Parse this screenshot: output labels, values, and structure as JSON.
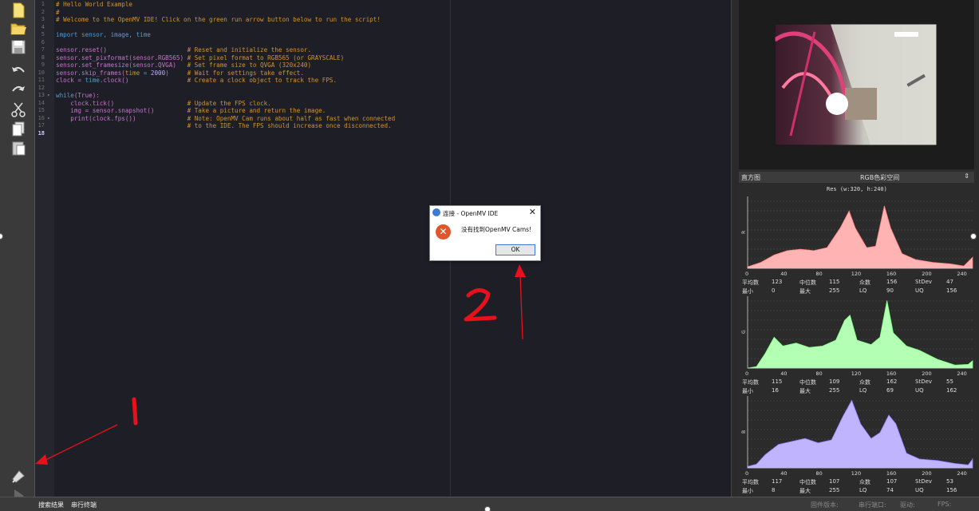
{
  "editor": {
    "lines": [
      {
        "n": "1",
        "parts": [
          {
            "t": "# Hello World Example",
            "c": "c-com"
          }
        ]
      },
      {
        "n": "2",
        "parts": [
          {
            "t": "#",
            "c": "c-com"
          }
        ]
      },
      {
        "n": "3",
        "parts": [
          {
            "t": "# Welcome to the OpenMV IDE! Click on the green run arrow button below to run the script!",
            "c": "c-com"
          }
        ]
      },
      {
        "n": "4",
        "parts": []
      },
      {
        "n": "5",
        "parts": [
          {
            "t": "import sensor, image, time",
            "c": "c-def"
          }
        ]
      },
      {
        "n": "6",
        "parts": []
      },
      {
        "n": "7",
        "parts": [
          {
            "t": "sensor.reset()                      ",
            "c": "c-fn"
          },
          {
            "t": "# Reset and initialize the sensor.",
            "c": "c-com"
          }
        ]
      },
      {
        "n": "8",
        "parts": [
          {
            "t": "sensor.set_pixformat(sensor.RGB565) ",
            "c": "c-fn"
          },
          {
            "t": "# Set pixel format to RGB565 (or GRAYSCALE)",
            "c": "c-com"
          }
        ]
      },
      {
        "n": "9",
        "parts": [
          {
            "t": "sensor.set_framesize(sensor.QVGA)   ",
            "c": "c-fn"
          },
          {
            "t": "# Set frame size to QVGA (320x240)",
            "c": "c-com"
          }
        ]
      },
      {
        "n": "10",
        "parts": [
          {
            "t": "sensor.skip_frames(",
            "c": "c-fn"
          },
          {
            "t": "time",
            "c": "c-com"
          },
          {
            "t": " = ",
            "c": "c-def"
          },
          {
            "t": "2000",
            "c": "c-num"
          },
          {
            "t": ")     ",
            "c": "c-fn"
          },
          {
            "t": "# Wait for settings take effect.",
            "c": "c-com"
          }
        ]
      },
      {
        "n": "11",
        "parts": [
          {
            "t": "clock = ",
            "c": "c-fn"
          },
          {
            "t": "time",
            "c": "c-def"
          },
          {
            "t": ".clock()                ",
            "c": "c-fn"
          },
          {
            "t": "# Create a clock object to track the FPS.",
            "c": "c-com"
          }
        ]
      },
      {
        "n": "12",
        "parts": []
      },
      {
        "n": "13",
        "parts": [
          {
            "t": "while",
            "c": "c-def"
          },
          {
            "t": "(True):",
            "c": "c-fn"
          }
        ]
      },
      {
        "n": "14",
        "parts": [
          {
            "t": "    clock.tick()                    ",
            "c": "c-fn"
          },
          {
            "t": "# Update the FPS clock.",
            "c": "c-com"
          }
        ]
      },
      {
        "n": "15",
        "parts": [
          {
            "t": "    img = sensor.snapshot()         ",
            "c": "c-fn"
          },
          {
            "t": "# Take a picture and return the image.",
            "c": "c-com"
          }
        ]
      },
      {
        "n": "16",
        "parts": [
          {
            "t": "    print(clock.fps())              ",
            "c": "c-fn"
          },
          {
            "t": "# Note: OpenMV Cam runs about half as fast when connected",
            "c": "c-com"
          }
        ]
      },
      {
        "n": "17",
        "parts": [
          {
            "t": "                                    ",
            "c": "c-fn"
          },
          {
            "t": "# to the IDE. The FPS should increase once disconnected.",
            "c": "c-com"
          }
        ]
      },
      {
        "n": "18",
        "parts": []
      }
    ]
  },
  "histogram": {
    "title": "直方图",
    "colorspace": "RGB色彩空间",
    "resolution": "Res (w:320, h:240)",
    "x_ticks": [
      "0",
      "40",
      "80",
      "120",
      "160",
      "200",
      "240"
    ],
    "channels": [
      {
        "label": "R",
        "color": "#ffb3b3",
        "stroke": "#ff8080",
        "stats": {
          "mean_label": "平均数",
          "mean": "123",
          "median_label": "中位数",
          "median": "115",
          "mode_label": "众数",
          "mode": "156",
          "stdev_label": "StDev",
          "stdev": "47",
          "min_label": "最小",
          "min": "0",
          "max_label": "最大",
          "max": "255",
          "lq_label": "LQ",
          "lq": "90",
          "uq_label": "UQ",
          "uq": "156"
        }
      },
      {
        "label": "G",
        "color": "#b3ffb3",
        "stroke": "#80ff80",
        "stats": {
          "mean_label": "平均数",
          "mean": "115",
          "median_label": "中位数",
          "median": "109",
          "mode_label": "众数",
          "mode": "162",
          "stdev_label": "StDev",
          "stdev": "55",
          "min_label": "最小",
          "min": "16",
          "max_label": "最大",
          "max": "255",
          "lq_label": "LQ",
          "lq": "69",
          "uq_label": "UQ",
          "uq": "162"
        }
      },
      {
        "label": "B",
        "color": "#c0b3ff",
        "stroke": "#9080ff",
        "stats": {
          "mean_label": "平均数",
          "mean": "117",
          "median_label": "中位数",
          "median": "107",
          "mode_label": "众数",
          "mode": "107",
          "stdev_label": "StDev",
          "stdev": "53",
          "min_label": "最小",
          "min": "8",
          "max_label": "最大",
          "max": "255",
          "lq_label": "LQ",
          "lq": "74",
          "uq_label": "UQ",
          "uq": "156"
        }
      }
    ]
  },
  "statusbar": {
    "search_results": "搜索结果",
    "serial_terminal": "串行终端",
    "firmware": "固件版本:",
    "serial_port": "串行端口:",
    "drive": "驱动:",
    "fps": "FPS:"
  },
  "dialog": {
    "title": "连接 - OpenMV IDE",
    "message": "没有找到OpenMV Cams!",
    "ok_label": "OK",
    "close_glyph": "✕",
    "error_glyph": "✕"
  },
  "annotations": {
    "label_1": "1",
    "label_2": "2",
    "color": "#e8101a"
  }
}
